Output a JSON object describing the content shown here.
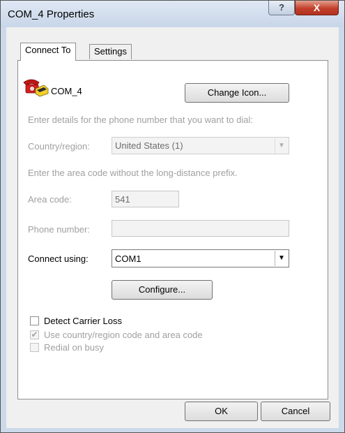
{
  "window": {
    "title": "COM_4 Properties",
    "help_glyph": "?",
    "close_glyph": "X"
  },
  "tabs": [
    {
      "label": "Connect To",
      "active": true
    },
    {
      "label": "Settings",
      "active": false
    }
  ],
  "connection": {
    "name": "COM_4",
    "icon": "phone-icon",
    "change_icon_label": "Change Icon..."
  },
  "hints": {
    "dial_details": "Enter details for the phone number that you want to dial:",
    "area_code_hint": "Enter the area code without the long-distance prefix."
  },
  "fields": {
    "country_label": "Country/region:",
    "country_value": "United States (1)",
    "area_code_label": "Area code:",
    "area_code_value": "541",
    "phone_label": "Phone number:",
    "phone_value": "",
    "connect_using_label": "Connect using:",
    "connect_using_value": "COM1"
  },
  "buttons": {
    "configure": "Configure...",
    "ok": "OK",
    "cancel": "Cancel"
  },
  "checkboxes": [
    {
      "label": "Detect Carrier Loss",
      "checked": false,
      "enabled": true
    },
    {
      "label": "Use country/region code and area code",
      "checked": true,
      "enabled": false
    },
    {
      "label": "Redial on busy",
      "checked": false,
      "enabled": false
    }
  ],
  "colors": {
    "frame": "#ccd9ea",
    "close_button": "#c2402b",
    "disabled_text": "#a0a0a0"
  }
}
